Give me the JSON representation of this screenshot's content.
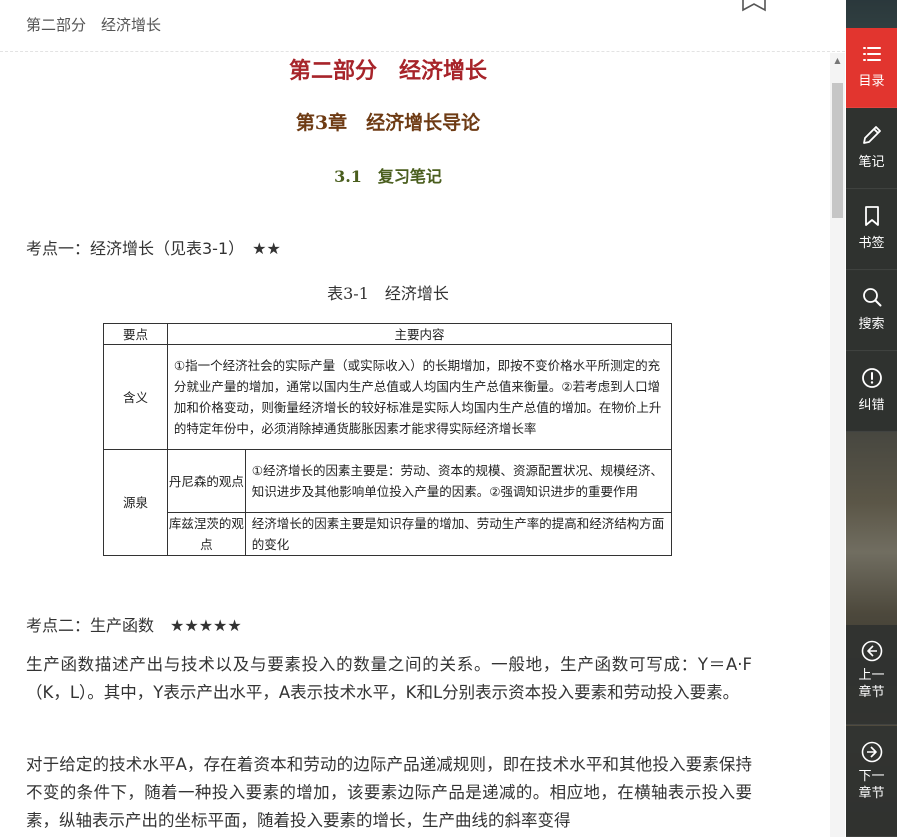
{
  "header": {
    "breadcrumb": "第二部分　经济增长"
  },
  "content": {
    "part_title": "第二部分　经济增长",
    "chapter_title": "第3章　经济增长导论",
    "section_title": "3.1　复习笔记",
    "point1": "考点一：经济增长（见表3-1）　★★",
    "table_caption": "表3-1　经济增长",
    "table": {
      "head_col1": "要点",
      "head_col2": "主要内容",
      "row1_label": "含义",
      "row1_text": "①指一个经济社会的实际产量（或实际收入）的长期增加，即按不变价格水平所测定的充分就业产量的增加，通常以国内生产总值或人均国内生产总值来衡量。②若考虑到人口增加和价格变动，则衡量经济增长的较好标准是实际人均国内生产总值的增加。在物价上升的特定年份中，必须消除掉通货膨胀因素才能求得实际经济增长率",
      "row2_label": "源泉",
      "row2_sub1_label": "丹尼森的观点",
      "row2_sub1_text": "①经济增长的因素主要是：劳动、资本的规模、资源配置状况、规模经济、知识进步及其他影响单位投入产量的因素。②强调知识进步的重要作用",
      "row2_sub2_label": "库兹涅茨的观点",
      "row2_sub2_text": "经济增长的因素主要是知识存量的增加、劳动生产率的提高和经济结构方面的变化"
    },
    "point2": "考点二：生产函数　★★★★★",
    "para1": "生产函数描述产出与技术以及与要素投入的数量之间的关系。一般地，生产函数可写成：Y＝A·F（K，L）。其中，Y表示产出水平，A表示技术水平，K和L分别表示资本投入要素和劳动投入要素。",
    "para2": "对于给定的技术水平A，存在着资本和劳动的边际产品递减规则，即在技术水平和其他投入要素保持不变的条件下，随着一种投入要素的增加，该要素边际产品是递减的。相应地，在横轴表示投入要素，纵轴表示产出的坐标平面，随着投入要素的增长，生产曲线的斜率变得"
  },
  "sidebar": {
    "toc": "目录",
    "notes": "笔记",
    "bookmark": "书签",
    "search": "搜索",
    "report": "纠错",
    "prev_line1": "上一",
    "prev_line2": "章节",
    "next_line1": "下一",
    "next_line2": "章节"
  },
  "colors": {
    "accent_red": "#e2352f",
    "part_title": "#a7242a",
    "chapter_title": "#6e3b14",
    "section_title": "#4a5e1e"
  },
  "icons": [
    "list-icon",
    "pencil-icon",
    "bookmark-icon",
    "search-icon",
    "alert-circle-icon",
    "arrow-left-circle-icon",
    "arrow-right-circle-icon"
  ]
}
